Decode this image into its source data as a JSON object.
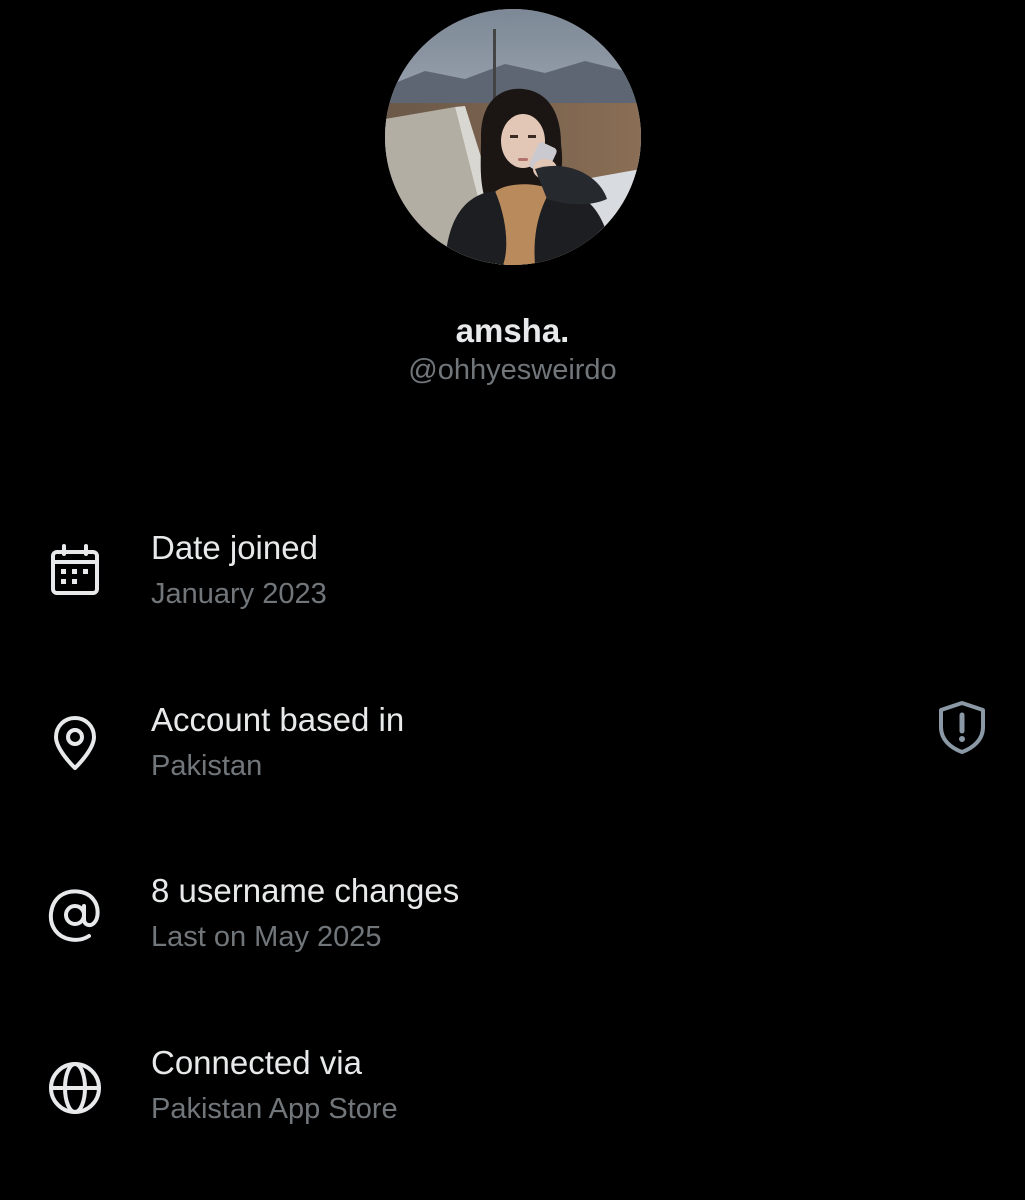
{
  "profile": {
    "display_name": "amsha.",
    "handle": "@ohhyesweirdo"
  },
  "details": {
    "joined": {
      "icon": "calendar-icon",
      "title": "Date joined",
      "value": "January 2023"
    },
    "location": {
      "icon": "location-pin-icon",
      "title": "Account based in",
      "value": "Pakistan",
      "badge_icon": "shield-alert-icon"
    },
    "username": {
      "icon": "at-sign-icon",
      "title": "8 username changes",
      "value": "Last on May 2025"
    },
    "connection": {
      "icon": "globe-icon",
      "title": "Connected via",
      "value": "Pakistan App Store"
    }
  },
  "colors": {
    "background": "#000000",
    "primary_text": "#e7e9ea",
    "secondary_text": "#71767b",
    "icon": "#e7e9ea",
    "shield": "#8b98a5"
  }
}
